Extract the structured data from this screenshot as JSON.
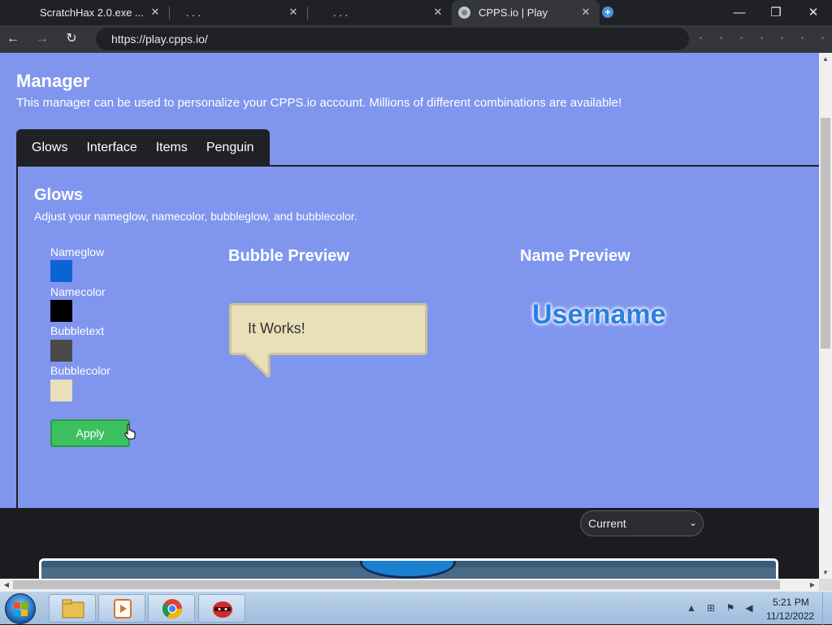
{
  "browser": {
    "tabs": [
      {
        "title": "ScratchHax 2.0.exe ...",
        "active": false
      },
      {
        "title": ". . .",
        "active": false
      },
      {
        "title": ". . .",
        "active": false
      },
      {
        "title": "CPPS.io | Play",
        "active": true
      }
    ],
    "close_glyph": "✕",
    "url": "https://play.cpps.io/",
    "window_controls": {
      "minimize": "—",
      "restore": "❐",
      "close": "✕"
    },
    "nav": {
      "back": "←",
      "forward": "→",
      "reload": "↻"
    },
    "new_tab_glyph": "+"
  },
  "page": {
    "manager": {
      "title": "Manager",
      "description": "This manager can be used to personalize your CPPS.io account. Millions of different combinations are available!"
    },
    "tabs": [
      "Glows",
      "Interface",
      "Items",
      "Penguin"
    ],
    "glows": {
      "title": "Glows",
      "description": "Adjust your nameglow, namecolor, bubbleglow, and bubblecolor.",
      "swatches": [
        {
          "label": "Nameglow",
          "color": "#0b63d6"
        },
        {
          "label": "Namecolor",
          "color": "#000000"
        },
        {
          "label": "Bubbletext",
          "color": "#4a4a4a"
        },
        {
          "label": "Bubblecolor",
          "color": "#e9dfb8"
        }
      ],
      "apply_label": "Apply"
    },
    "bubble_preview": {
      "title": "Bubble Preview",
      "text": "It Works!"
    },
    "name_preview": {
      "title": "Name Preview",
      "text": "Username"
    },
    "select": {
      "value": "Current",
      "chevron": "⌄"
    }
  },
  "taskbar": {
    "clock_time": "5:21 PM",
    "clock_date": "11/12/2022",
    "tray_icons": [
      "up-arrow-icon",
      "network-icon",
      "flag-icon",
      "volume-icon"
    ]
  },
  "colors": {
    "page_bg": "#8096ee",
    "dark": "#202124",
    "apply_green": "#3cc060",
    "username_blue": "#2a7fe0"
  }
}
